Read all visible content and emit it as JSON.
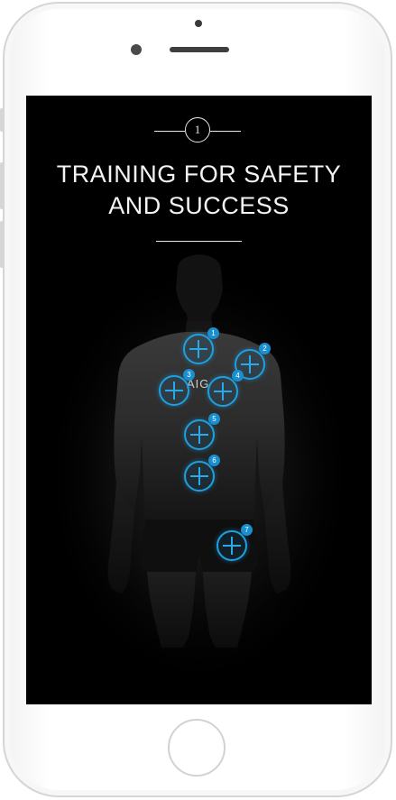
{
  "step_number": "1",
  "title_line1": "TRAINING FOR SAFETY",
  "title_line2": "AND SUCCESS",
  "jersey_text": "AIG",
  "hotspots": [
    {
      "number": "1"
    },
    {
      "number": "2"
    },
    {
      "number": "3"
    },
    {
      "number": "4"
    },
    {
      "number": "5"
    },
    {
      "number": "6"
    },
    {
      "number": "7"
    }
  ],
  "accent_color": "#1ea0e0"
}
